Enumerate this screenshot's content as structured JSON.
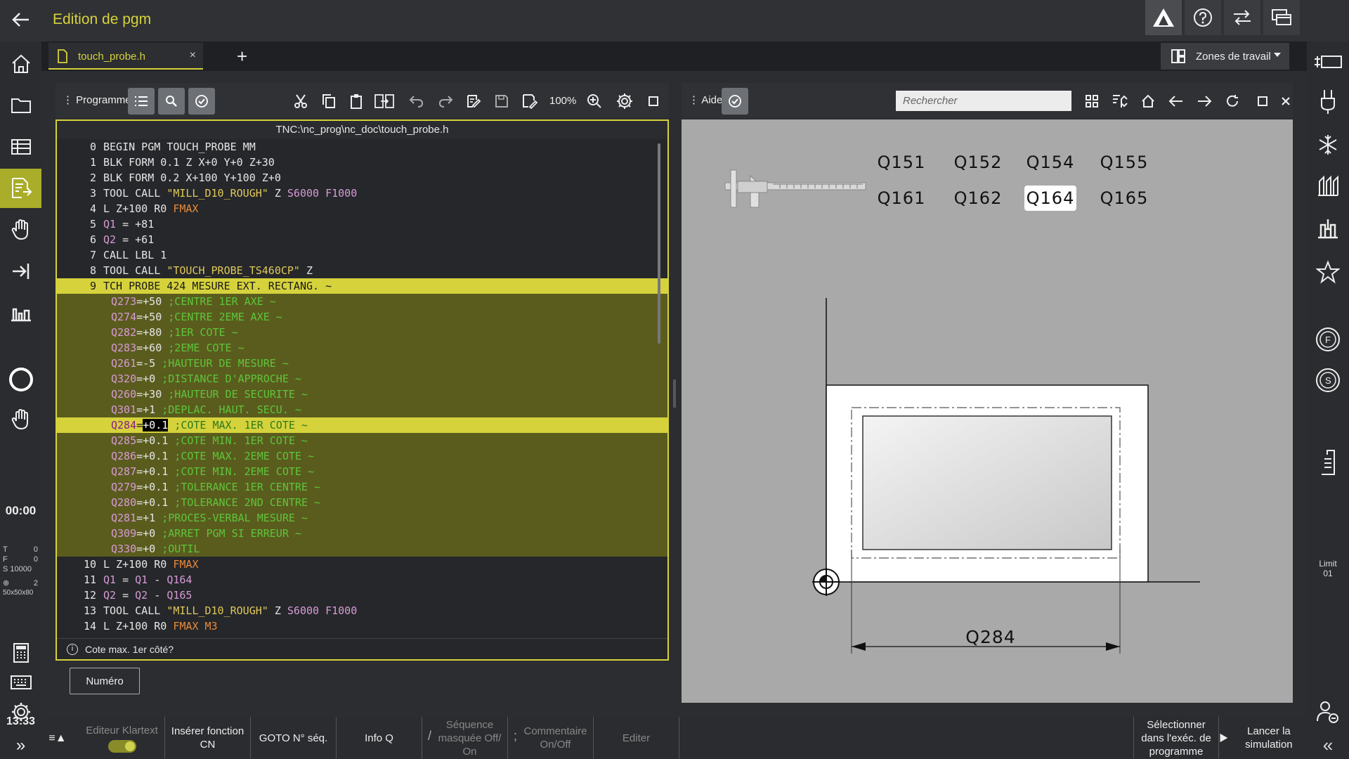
{
  "window": {
    "title": "Edition de pgm"
  },
  "tabs": {
    "file": "touch_probe.h",
    "close": "×",
    "add": "+"
  },
  "workspace": {
    "zones_label": "Zones de travail"
  },
  "program_panel": {
    "title": "Programme",
    "zoom": "100%",
    "path": "TNC:\\nc_prog\\nc_doc\\touch_probe.h",
    "hint": "Cote max. 1er côté?",
    "info_glyph": "i",
    "numero_label": "Numéro"
  },
  "code_lines": [
    {
      "n": "0",
      "t": "BEGIN PGM TOUCH_PROBE MM"
    },
    {
      "n": "1",
      "t": "BLK FORM 0.1 Z X+0 Y+0 Z+30"
    },
    {
      "n": "2",
      "t": "BLK FORM 0.2 X+100 Y+100 Z+0"
    },
    {
      "n": "3",
      "a": "TOOL CALL ",
      "s": "\"MILL_D10_ROUGH\"",
      "b": " Z ",
      "p": "S6000 F1000"
    },
    {
      "n": "4",
      "a": "L Z+100 R0 ",
      "f": "FMAX"
    },
    {
      "n": "5",
      "q": "Q1",
      "b": " = +81"
    },
    {
      "n": "6",
      "q": "Q2",
      "b": " = +61"
    },
    {
      "n": "7",
      "t": "CALL LBL 1"
    },
    {
      "n": "8",
      "a": "TOOL CALL ",
      "s": "\"TOUCH_PROBE_TS460CP\"",
      "b": " Z"
    }
  ],
  "cycle_line": {
    "n": "9",
    "t": "TCH PROBE 424 MESURE EXT. RECTANG. ~"
  },
  "cycle_params": [
    {
      "q": "Q273",
      "v": "=+50",
      "c": " ;CENTRE 1ER AXE ~"
    },
    {
      "q": "Q274",
      "v": "=+50",
      "c": " ;CENTRE 2EME AXE ~"
    },
    {
      "q": "Q282",
      "v": "=+80",
      "c": " ;1ER COTE ~"
    },
    {
      "q": "Q283",
      "v": "=+60",
      "c": " ;2EME COTE ~"
    },
    {
      "q": "Q261",
      "v": "=-5",
      "c": " ;HAUTEUR DE MESURE ~"
    },
    {
      "q": "Q320",
      "v": "=+0",
      "c": " ;DISTANCE D'APPROCHE ~"
    },
    {
      "q": "Q260",
      "v": "=+30",
      "c": " ;HAUTEUR DE SECURITE ~"
    },
    {
      "q": "Q301",
      "v": "=+1",
      "c": " ;DEPLAC. HAUT. SECU. ~"
    }
  ],
  "current_param": {
    "q": "Q284",
    "eq": "=",
    "v": "+0.1",
    "c": " ;COTE MAX. 1ER COTE ~"
  },
  "cycle_params_2": [
    {
      "q": "Q285",
      "v": "=+0.1",
      "c": " ;COTE MIN. 1ER COTE ~"
    },
    {
      "q": "Q286",
      "v": "=+0.1",
      "c": " ;COTE MAX. 2EME COTE ~"
    },
    {
      "q": "Q287",
      "v": "=+0.1",
      "c": " ;COTE MIN. 2EME COTE ~"
    },
    {
      "q": "Q279",
      "v": "=+0.1",
      "c": " ;TOLERANCE 1ER CENTRE ~"
    },
    {
      "q": "Q280",
      "v": "=+0.1",
      "c": " ;TOLERANCE 2ND CENTRE ~"
    },
    {
      "q": "Q281",
      "v": "=+1",
      "c": " ;PROCES-VERBAL MESURE ~"
    },
    {
      "q": "Q309",
      "v": "=+0",
      "c": " ;ARRET PGM SI ERREUR ~"
    },
    {
      "q": "Q330",
      "v": "=+0",
      "c": " ;OUTIL"
    }
  ],
  "code_lines_after": [
    {
      "n": "10",
      "a": "L Z+100 R0 ",
      "f": "FMAX"
    },
    {
      "n": "11",
      "q": "Q1",
      "b": " = ",
      "q2": "Q1",
      "b2": " - ",
      "q3": "Q164"
    },
    {
      "n": "12",
      "q": "Q2",
      "b": " = ",
      "q2": "Q2",
      "b2": " - ",
      "q3": "Q165"
    },
    {
      "n": "13",
      "a": "TOOL CALL ",
      "s": "\"MILL_D10_ROUGH\"",
      "b": " Z ",
      "p": "S6000 F1000"
    },
    {
      "n": "14",
      "a": "L Z+100 R0 ",
      "f": "FMAX M3"
    }
  ],
  "help_panel": {
    "title": "Aide",
    "search_placeholder": "Rechercher",
    "q_buttons_row1": [
      "Q151",
      "Q152",
      "Q154",
      "Q155"
    ],
    "q_buttons_row2": [
      "Q161",
      "Q162",
      "Q164",
      "Q165"
    ],
    "selected_q": "Q164",
    "dimension_label": "Q284"
  },
  "left_status": {
    "time": "00:00",
    "T": "T",
    "T_val": "0",
    "F": "F",
    "F_val": "0",
    "S": "S 10000",
    "probe_val": "2",
    "blank": "50x50x80",
    "clock": "13:33",
    "expand": "»"
  },
  "right_status": {
    "limit": "Limit",
    "limit_val": "01"
  },
  "softkeys": {
    "klartext": "Editeur Klartext",
    "insert_nc": "Insérer fonction CN",
    "goto": "GOTO N° séq.",
    "info_q": "Info Q",
    "masked": "Séquence masquée Off/ On",
    "comment": "Commentaire On/Off",
    "edit": "Editer",
    "select_prog": "Sélectionner dans l'exéc. de programme",
    "sim": "Lancer la simulation",
    "menu_glyph": "≡▲",
    "slash_glyph": "/",
    "semicolon_glyph": ";",
    "collapse_glyph": "«"
  },
  "colors": {
    "accent": "#d6d23c",
    "highlight_block": "#5a5c1e",
    "help_bg": "#a9a9a9"
  }
}
